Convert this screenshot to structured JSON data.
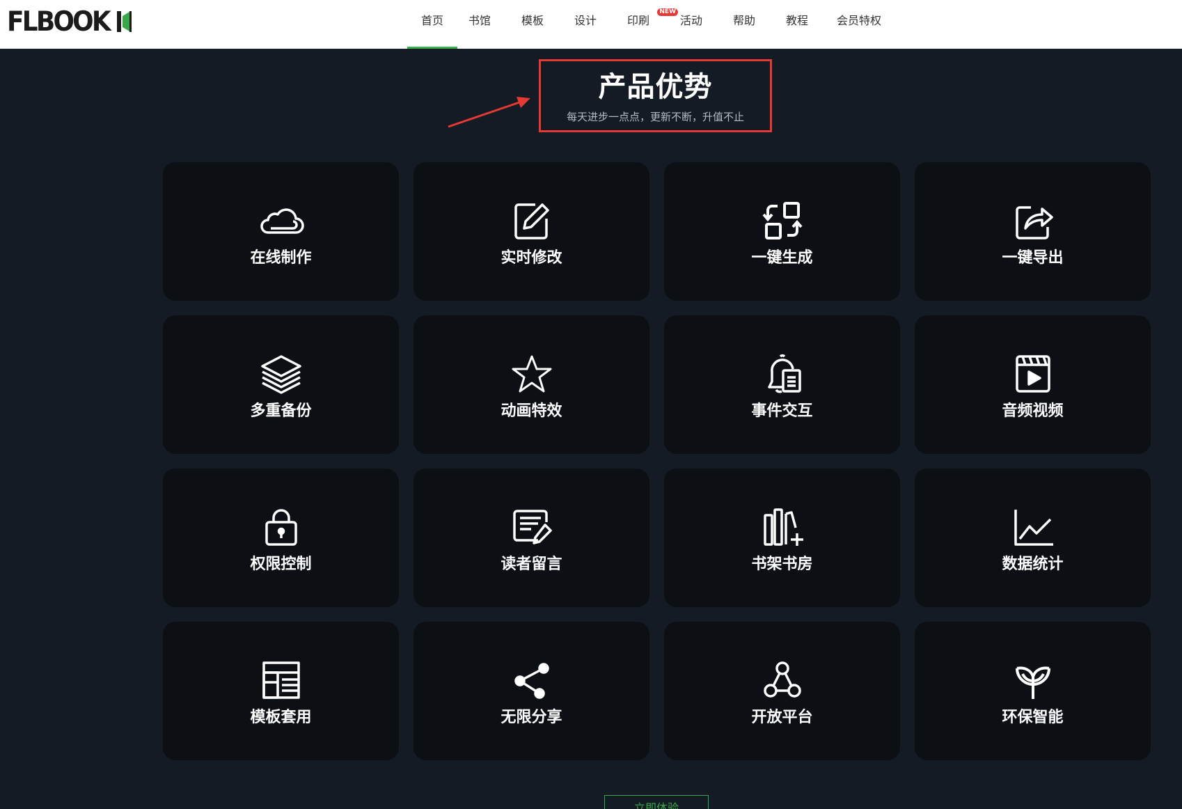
{
  "header": {
    "logo": "FLBOOK",
    "nav": [
      {
        "label": "首页",
        "active": true
      },
      {
        "label": "书馆",
        "active": false
      },
      {
        "label": "模板",
        "active": false
      },
      {
        "label": "设计",
        "active": false
      },
      {
        "label": "印刷",
        "active": false,
        "badge": "NEW"
      },
      {
        "label": "活动",
        "active": false
      },
      {
        "label": "帮助",
        "active": false
      },
      {
        "label": "教程",
        "active": false
      },
      {
        "label": "会员特权",
        "active": false
      }
    ]
  },
  "section": {
    "title": "产品优势",
    "subtitle": "每天进步一点点，更新不断，升值不止"
  },
  "features": [
    {
      "label": "在线制作",
      "icon": "cloud-icon"
    },
    {
      "label": "实时修改",
      "icon": "edit-icon"
    },
    {
      "label": "一键生成",
      "icon": "generate-icon"
    },
    {
      "label": "一键导出",
      "icon": "export-icon"
    },
    {
      "label": "多重备份",
      "icon": "layers-icon"
    },
    {
      "label": "动画特效",
      "icon": "star-icon"
    },
    {
      "label": "事件交互",
      "icon": "bell-icon"
    },
    {
      "label": "音频视频",
      "icon": "video-icon"
    },
    {
      "label": "权限控制",
      "icon": "lock-icon"
    },
    {
      "label": "读者留言",
      "icon": "comment-icon"
    },
    {
      "label": "书架书房",
      "icon": "bookshelf-icon"
    },
    {
      "label": "数据统计",
      "icon": "chart-icon"
    },
    {
      "label": "模板套用",
      "icon": "template-icon"
    },
    {
      "label": "无限分享",
      "icon": "share-icon"
    },
    {
      "label": "开放平台",
      "icon": "network-icon"
    },
    {
      "label": "环保智能",
      "icon": "eco-icon"
    }
  ],
  "cta": {
    "label": "立即体验"
  },
  "colors": {
    "accent": "#36b34a",
    "background": "#151b24",
    "card": "#0c0f14",
    "highlight": "#e53935"
  }
}
